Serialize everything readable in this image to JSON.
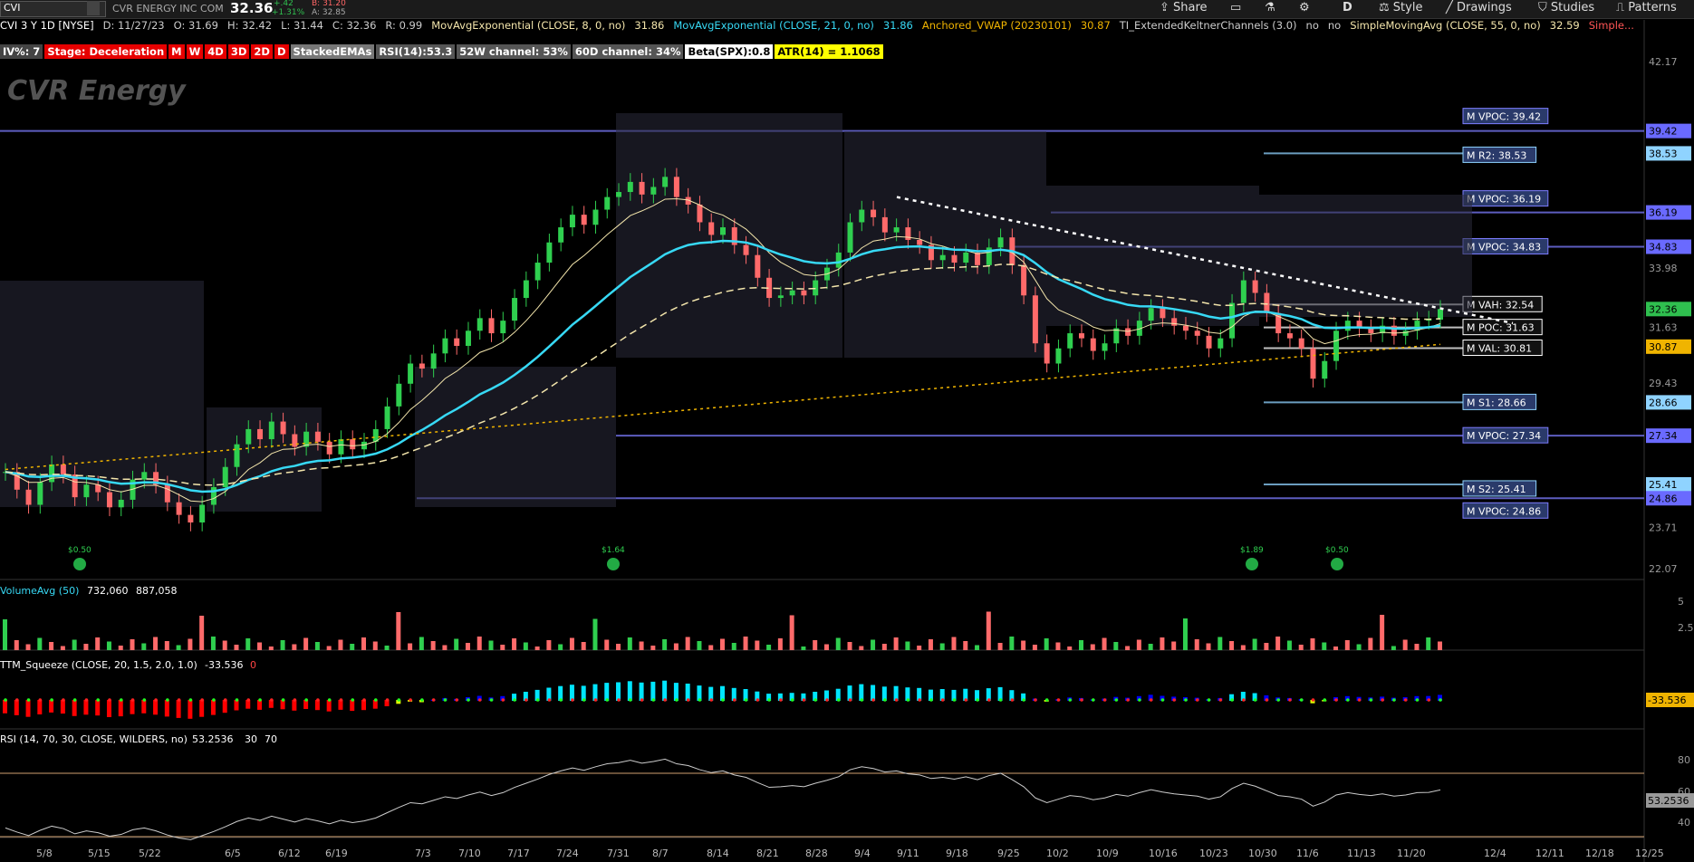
{
  "header": {
    "symbol": "CVI",
    "company": "CVR ENERGY INC COM",
    "last": "32.36",
    "change": "+.42",
    "change_pct": "+1.31%",
    "bid": "B: 31.20",
    "ask": "A: 32.85",
    "buttons": [
      "Share",
      "Style",
      "Drawings",
      "Studies",
      "Patterns"
    ],
    "aggregation": "D"
  },
  "study_line": [
    {
      "text": "CVI 3 Y 1D [NYSE]",
      "color": "#ffffff"
    },
    {
      "text": "D: 11/27/23",
      "color": "#cccccc"
    },
    {
      "text": "O: 31.69",
      "color": "#cccccc"
    },
    {
      "text": "H: 32.42",
      "color": "#cccccc"
    },
    {
      "text": "L: 31.44",
      "color": "#cccccc"
    },
    {
      "text": "C: 32.36",
      "color": "#cccccc"
    },
    {
      "text": "R: 0.99",
      "color": "#cccccc"
    },
    {
      "text": "MovAvgExponential (CLOSE, 8, 0, no)",
      "color": "#f3e5ab"
    },
    {
      "text": "31.86",
      "color": "#f3e5ab"
    },
    {
      "text": "MovAvgExponential (CLOSE, 21, 0, no)",
      "color": "#37d9f5"
    },
    {
      "text": "31.86",
      "color": "#37d9f5"
    },
    {
      "text": "Anchored_VWAP (20230101)",
      "color": "#f0b400"
    },
    {
      "text": "30.87",
      "color": "#f0b400"
    },
    {
      "text": "TI_ExtendedKeltnerChannels (3.0)",
      "color": "#cccccc"
    },
    {
      "text": "no",
      "color": "#cccccc"
    },
    {
      "text": "no",
      "color": "#cccccc"
    },
    {
      "text": "SimpleMovingAvg (CLOSE, 55, 0, no)",
      "color": "#f3e5ab"
    },
    {
      "text": "32.59",
      "color": "#f3e5ab"
    },
    {
      "text": "Simple...",
      "color": "#ff5555"
    }
  ],
  "badges": [
    {
      "text": "IV%: 7",
      "bg": "#444444",
      "fg": "#ffffff"
    },
    {
      "text": "Stage: Deceleration",
      "bg": "#e60000",
      "fg": "#ffffff"
    },
    {
      "text": "M",
      "bg": "#e60000",
      "fg": "#ffffff"
    },
    {
      "text": "W",
      "bg": "#e60000",
      "fg": "#ffffff"
    },
    {
      "text": "4D",
      "bg": "#e60000",
      "fg": "#ffffff"
    },
    {
      "text": "3D",
      "bg": "#e60000",
      "fg": "#ffffff"
    },
    {
      "text": "2D",
      "bg": "#e60000",
      "fg": "#ffffff"
    },
    {
      "text": "D",
      "bg": "#e60000",
      "fg": "#ffffff"
    },
    {
      "text": "StackedEMAs",
      "bg": "#777777",
      "fg": "#ffffff"
    },
    {
      "text": "RSI(14):53.3",
      "bg": "#555555",
      "fg": "#ffffff"
    },
    {
      "text": "52W channel: 53%",
      "bg": "#555555",
      "fg": "#ffffff"
    },
    {
      "text": "60D channel: 34%",
      "bg": "#555555",
      "fg": "#ffffff"
    },
    {
      "text": "Beta(SPX):0.8",
      "bg": "#ffffff",
      "fg": "#000000"
    },
    {
      "text": "ATR(14) = 1.1068",
      "bg": "#ffff00",
      "fg": "#000000"
    }
  ],
  "watermark": "CVR Energy",
  "chart_data": {
    "type": "candlestick",
    "y_axis_ticks": [
      "42.17",
      "39.42",
      "38.53",
      "36.19",
      "34.83",
      "33.98",
      "32.36",
      "31.63",
      "30.87",
      "29.43",
      "28.66",
      "27.34",
      "25.41",
      "24.86",
      "23.71",
      "22.07"
    ],
    "x_axis_ticks": [
      "5/8",
      "5/15",
      "5/22",
      "6/5",
      "6/12",
      "6/19",
      "7/3",
      "7/10",
      "7/17",
      "7/24",
      "7/31",
      "8/7",
      "8/14",
      "8/21",
      "8/28",
      "9/4",
      "9/11",
      "9/18",
      "9/25",
      "10/2",
      "10/9",
      "10/16",
      "10/23",
      "10/30",
      "11/6",
      "11/13",
      "11/20",
      "12/4",
      "12/11",
      "12/18",
      "12/25"
    ],
    "ylim": [
      22.07,
      42.17
    ],
    "level_labels": [
      {
        "text": "M VPOC: 39.42",
        "value": 39.42
      },
      {
        "text": "M R2: 38.53",
        "value": 38.53
      },
      {
        "text": "M VPOC: 36.19",
        "value": 36.19
      },
      {
        "text": "M VPOC: 34.83",
        "value": 34.83
      },
      {
        "text": "M VAH: 32.54",
        "value": 32.54
      },
      {
        "text": "M POC: 31.63",
        "value": 31.63
      },
      {
        "text": "M VAL: 30.81",
        "value": 30.81
      },
      {
        "text": "M S1: 28.66",
        "value": 28.66
      },
      {
        "text": "M VPOC: 27.34",
        "value": 27.34
      },
      {
        "text": "M S2: 25.41",
        "value": 25.41
      },
      {
        "text": "M VPOC: 24.86",
        "value": 24.86
      }
    ],
    "price_tags": [
      {
        "text": "39.42",
        "value": 39.42,
        "color": "#6a6aff"
      },
      {
        "text": "38.53",
        "value": 38.53,
        "color": "#8fd3ff"
      },
      {
        "text": "36.19",
        "value": 36.19,
        "color": "#6a6aff"
      },
      {
        "text": "34.83",
        "value": 34.83,
        "color": "#6a6aff"
      },
      {
        "text": "32.36",
        "value": 32.36,
        "color": "#2fbf4f"
      },
      {
        "text": "30.87",
        "value": 30.87,
        "color": "#f0b400"
      },
      {
        "text": "28.66",
        "value": 28.66,
        "color": "#8fd3ff"
      },
      {
        "text": "27.34",
        "value": 27.34,
        "color": "#6a6aff"
      },
      {
        "text": "25.41",
        "value": 25.41,
        "color": "#8fd3ff"
      },
      {
        "text": "24.86",
        "value": 24.86,
        "color": "#6a6aff"
      }
    ],
    "dividends": [
      {
        "text": "$0.50",
        "date": "5/15"
      },
      {
        "text": "$1.64",
        "date": "7/31"
      },
      {
        "text": "$1.89",
        "date": "10/30"
      },
      {
        "text": "$0.50",
        "date": "11/13"
      }
    ],
    "candles_close": [
      25.9,
      25.2,
      24.6,
      25.5,
      26.2,
      25.8,
      24.9,
      25.4,
      25.1,
      24.5,
      24.8,
      25.6,
      25.9,
      25.4,
      24.7,
      24.2,
      23.9,
      24.6,
      25.3,
      26.1,
      27.0,
      27.6,
      27.2,
      27.9,
      27.4,
      26.9,
      27.5,
      27.1,
      26.6,
      27.2,
      26.8,
      27.1,
      27.6,
      28.5,
      29.4,
      30.2,
      30.0,
      30.6,
      31.2,
      30.9,
      31.5,
      32.0,
      31.4,
      31.9,
      32.8,
      33.5,
      34.2,
      35.0,
      35.6,
      36.1,
      35.7,
      36.3,
      36.8,
      37.0,
      37.4,
      36.9,
      37.2,
      37.6,
      36.8,
      36.5,
      35.8,
      35.3,
      35.6,
      34.9,
      34.5,
      33.6,
      32.8,
      32.9,
      33.1,
      32.9,
      33.5,
      34.0,
      34.6,
      35.8,
      36.3,
      36.0,
      35.4,
      35.6,
      35.1,
      34.9,
      34.3,
      34.5,
      34.2,
      34.6,
      34.1,
      34.8,
      35.2,
      34.1,
      32.9,
      31.0,
      30.2,
      30.8,
      31.4,
      31.2,
      30.7,
      31.0,
      31.6,
      31.3,
      31.9,
      32.4,
      32.0,
      31.7,
      31.5,
      31.3,
      30.8,
      31.2,
      32.6,
      33.5,
      33.0,
      32.2,
      31.4,
      31.2,
      30.8,
      29.6,
      30.3,
      31.5,
      31.9,
      31.6,
      31.4,
      31.7,
      31.3,
      31.5,
      31.9,
      31.94,
      32.36
    ],
    "volume_study": {
      "name": "VolumeAvg (50)",
      "values": [
        "732,060",
        "887,058"
      ]
    },
    "squeeze_study": {
      "name": "TTM_Squeeze (CLOSE, 20, 1.5, 2.0, 1.0)",
      "value": "-33.536",
      "flag": "0",
      "tag": "-33.536"
    },
    "rsi_study": {
      "name": "RSI (14, 70, 30, CLOSE, WILDERS, no)",
      "value": "53.2536",
      "ob": "30",
      "os": "70",
      "ticks": [
        "80",
        "60",
        "40"
      ],
      "tag": "53.2536"
    },
    "volume_ticks": [
      "5",
      "2.5"
    ]
  }
}
